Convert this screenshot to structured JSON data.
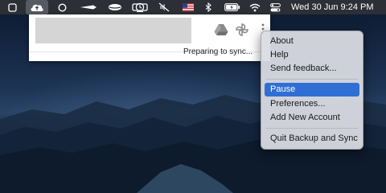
{
  "menubar": {
    "clock": "Wed 30 Jun  9:24 PM",
    "icons": [
      "window-icon",
      "backup-sync-cloud-icon",
      "circle-icon",
      "app-arrow-icon",
      "lips-icon",
      "tv-icon",
      "time-machine-icon",
      "mute-icon",
      "us-flag-icon",
      "bluetooth-icon",
      "battery-icon",
      "wifi-icon",
      "control-center-icon"
    ]
  },
  "panel": {
    "status": "Preparing to sync...",
    "icons": [
      "google-drive-icon",
      "google-photos-icon",
      "more-vertical-icon"
    ]
  },
  "menu": {
    "items": [
      {
        "label": "About"
      },
      {
        "label": "Help"
      },
      {
        "label": "Send feedback..."
      },
      {
        "label": "Pause"
      },
      {
        "label": "Preferences..."
      },
      {
        "label": "Add New Account"
      },
      {
        "label": "Quit Backup and Sync"
      }
    ],
    "selected": "Pause"
  },
  "colors": {
    "menubar": "#2c2f36",
    "highlight": "#2f6ed4",
    "panel": "#ffffff"
  }
}
